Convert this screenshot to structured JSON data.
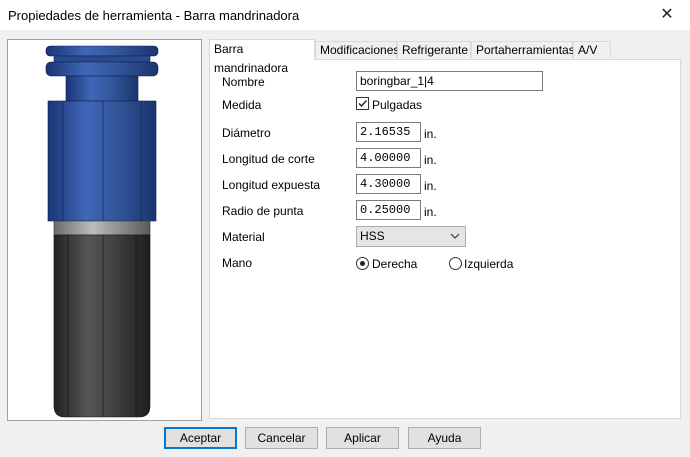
{
  "window": {
    "title": "Propiedades de herramienta - Barra mandrinadora",
    "close_glyph": "✕"
  },
  "tabs": [
    {
      "label": "Barra mandrinadora",
      "active": true
    },
    {
      "label": "Modificaciones",
      "active": false
    },
    {
      "label": "Refrigerante",
      "active": false
    },
    {
      "label": "Portaherramientas",
      "active": false
    },
    {
      "label": "A/V",
      "active": false
    }
  ],
  "form": {
    "nombre": {
      "label": "Nombre",
      "value": "boringbar_1|4"
    },
    "medida": {
      "label": "Medida",
      "checkbox_label": "Pulgadas",
      "checked": true
    },
    "diametro": {
      "label": "Diámetro",
      "value": "2.16535",
      "unit": "in."
    },
    "longitud_corte": {
      "label": "Longitud de corte",
      "value": "4.00000",
      "unit": "in."
    },
    "longitud_expuesta": {
      "label": "Longitud expuesta",
      "value": "4.30000",
      "unit": "in."
    },
    "radio_punta": {
      "label": "Radio de punta",
      "value": "0.25000",
      "unit": "in."
    },
    "material": {
      "label": "Material",
      "value": "HSS"
    },
    "mano": {
      "label": "Mano",
      "options": [
        {
          "label": "Derecha",
          "selected": true
        },
        {
          "label": "Izquierda",
          "selected": false
        }
      ]
    }
  },
  "buttons": {
    "accept": "Aceptar",
    "cancel": "Cancelar",
    "apply": "Aplicar",
    "help": "Ayuda"
  },
  "colors": {
    "holder_blue": "#2d4f9a",
    "bar_dark": "#3a3a3a",
    "accent": "#0078d7"
  },
  "icons": {
    "close": "close-icon",
    "check": "check-icon",
    "dropdown": "chevron-down-icon"
  }
}
